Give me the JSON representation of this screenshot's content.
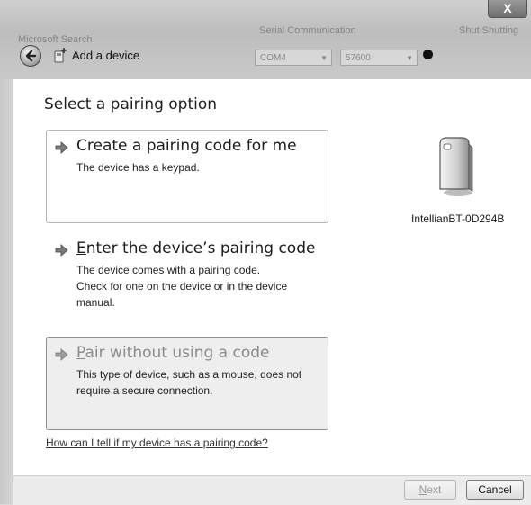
{
  "window": {
    "title": "Add a device",
    "close_label": "X"
  },
  "background_window": {
    "search_label": "Microsoft Search",
    "group_label": "Serial Communication",
    "right_label": "Shut Shutting",
    "port_value": "COM4",
    "baud_value": "57600"
  },
  "page": {
    "heading": "Select a pairing option",
    "options": [
      {
        "title": "Create a pairing code for me",
        "description": "The device has a keypad."
      },
      {
        "title_prefix": "E",
        "title_rest": "nter the device’s pairing code",
        "description": "The device comes with a pairing code.\nCheck for one on the device or in the device\nmanual."
      },
      {
        "title_prefix": "P",
        "title_rest": "air without using a code",
        "description": "This type of device, such as a mouse, does not\nrequire a secure connection."
      }
    ],
    "help_link": "How can I tell if my device has a pairing code?"
  },
  "device": {
    "name": "IntellianBT-0D294B",
    "icon": "generic-device-icon"
  },
  "footer": {
    "next_prefix": "N",
    "next_rest": "ext",
    "cancel_label": "Cancel"
  }
}
